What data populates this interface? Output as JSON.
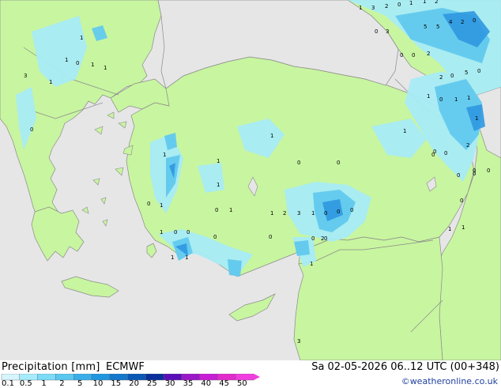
{
  "legend": {
    "title": "Precipitation [mm]",
    "model": "ECMWF",
    "valid_time": "Sa 02-05-2026 06..12 UTC (00+348)",
    "credit": "©weatheronline.co.uk",
    "scale_labels": [
      "0.1",
      "0.5",
      "1",
      "2",
      "5",
      "10",
      "15",
      "20",
      "25",
      "30",
      "35",
      "40",
      "45",
      "50"
    ],
    "scale_colors": [
      "#d6f5ff",
      "#a6ecff",
      "#7cdcf8",
      "#5ac8f0",
      "#3aaee8",
      "#2196e0",
      "#1478cc",
      "#0a58b4",
      "#0a2e9a",
      "#5a0eb8",
      "#9a18c8",
      "#c81ed6",
      "#e22ccc",
      "#f23ee0"
    ]
  },
  "colors": {
    "sea": "#e6e6e6",
    "land": "#c8f5a0",
    "precip_light": "#a8ecf6",
    "precip_med": "#62caee",
    "precip_heavy": "#2f98e0"
  },
  "map_labels": [
    {
      "t": "1"
    },
    {
      "t": "3"
    },
    {
      "t": "2"
    },
    {
      "t": "0"
    },
    {
      "t": "1"
    },
    {
      "t": "1"
    },
    {
      "t": "2"
    },
    {
      "t": "0"
    },
    {
      "t": "0"
    },
    {
      "t": "3"
    },
    {
      "t": "5"
    },
    {
      "t": "5"
    },
    {
      "t": "4"
    },
    {
      "t": "2"
    },
    {
      "t": "1"
    },
    {
      "t": "1"
    },
    {
      "t": "0"
    },
    {
      "t": "1"
    },
    {
      "t": "1"
    },
    {
      "t": "3"
    },
    {
      "t": "1"
    },
    {
      "t": "0"
    },
    {
      "t": "0"
    },
    {
      "t": "2"
    },
    {
      "t": "2"
    },
    {
      "t": "0"
    },
    {
      "t": "5"
    },
    {
      "t": "0"
    },
    {
      "t": "1"
    },
    {
      "t": "0"
    },
    {
      "t": "1"
    },
    {
      "t": "1"
    },
    {
      "t": "1"
    },
    {
      "t": "2"
    },
    {
      "t": "0"
    },
    {
      "t": "0"
    },
    {
      "t": "1"
    },
    {
      "t": "1"
    },
    {
      "t": "1"
    },
    {
      "t": "0"
    },
    {
      "t": "1"
    },
    {
      "t": "1"
    },
    {
      "t": "0"
    },
    {
      "t": "0"
    },
    {
      "t": "1"
    },
    {
      "t": "0"
    },
    {
      "t": "0"
    },
    {
      "t": "0"
    },
    {
      "t": "0"
    },
    {
      "t": "0"
    },
    {
      "t": "1"
    },
    {
      "t": "1"
    },
    {
      "t": "2"
    },
    {
      "t": "3"
    },
    {
      "t": "1"
    },
    {
      "t": "0"
    },
    {
      "t": "0"
    },
    {
      "t": "0"
    },
    {
      "t": "0"
    },
    {
      "t": "1"
    },
    {
      "t": "1"
    },
    {
      "t": "1"
    },
    {
      "t": "0"
    },
    {
      "t": "0"
    },
    {
      "t": "0"
    },
    {
      "t": "0"
    },
    {
      "t": "0"
    },
    {
      "t": "0"
    },
    {
      "t": "1"
    },
    {
      "t": "1"
    },
    {
      "t": "1"
    },
    {
      "t": "2"
    },
    {
      "t": "0"
    },
    {
      "t": "0"
    },
    {
      "t": "3"
    }
  ]
}
